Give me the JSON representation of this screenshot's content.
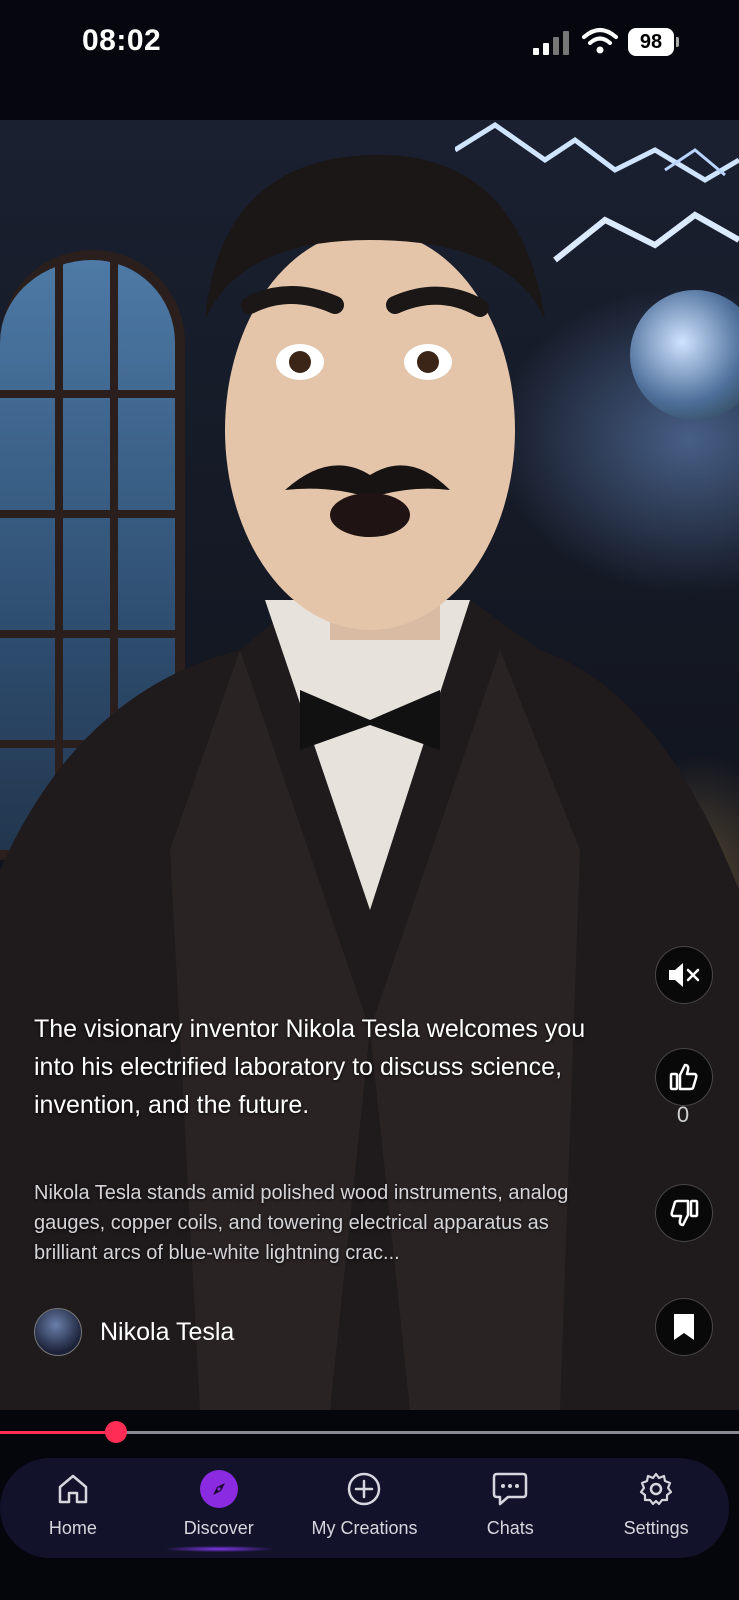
{
  "status_bar": {
    "time": "08:02",
    "battery": "98"
  },
  "video": {
    "title": "The visionary inventor Nikola Tesla welcomes you into his electrified laboratory to discuss science, invention, and the future.",
    "description": "Nikola Tesla stands amid polished wood instruments, analog gauges, copper coils, and towering electrical apparatus as brilliant arcs of blue-white lightning crac...",
    "author": "Nikola Tesla",
    "like_count": "0",
    "progress": 0.157
  },
  "side_actions": {
    "mute_icon": "speaker-muted-icon",
    "like_icon": "thumbs-up-icon",
    "dislike_icon": "thumbs-down-icon",
    "bookmark_icon": "bookmark-icon"
  },
  "nav": {
    "items": [
      {
        "label": "Home",
        "icon": "home-icon"
      },
      {
        "label": "Discover",
        "icon": "compass-icon",
        "active": true
      },
      {
        "label": "My Creations",
        "icon": "plus-circle-icon"
      },
      {
        "label": "Chats",
        "icon": "chat-icon"
      },
      {
        "label": "Settings",
        "icon": "gear-icon"
      }
    ]
  },
  "colors": {
    "accent": "#8a2be2",
    "progress": "#ff2d55",
    "nav_bg": "#12122a"
  }
}
